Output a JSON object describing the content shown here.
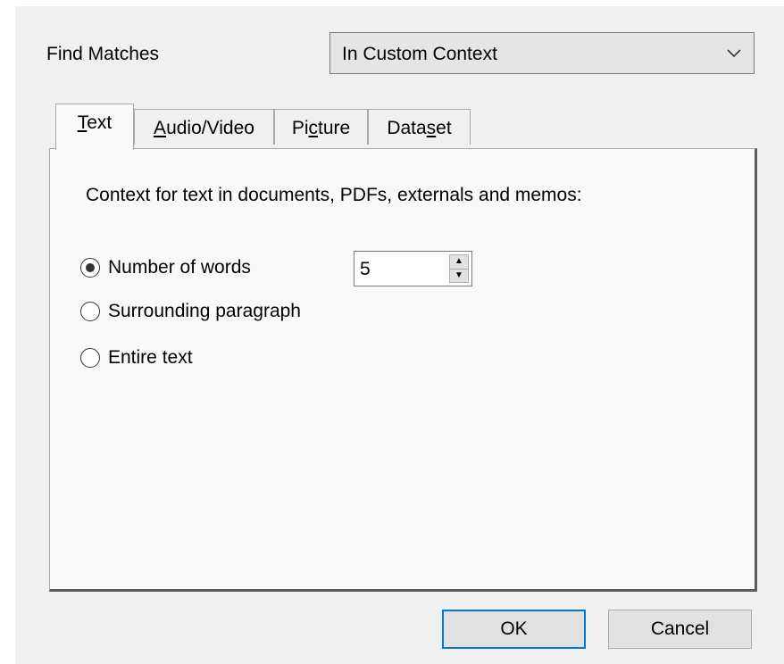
{
  "find_matches": {
    "label": "Find Matches",
    "selected": "In Custom Context",
    "chevron_icon": "chevron-down-icon"
  },
  "tabs": [
    {
      "pre": "",
      "mnemonic": "T",
      "post": "ext",
      "active": true
    },
    {
      "pre": "",
      "mnemonic": "A",
      "post": "udio/Video",
      "active": false
    },
    {
      "pre": "Pi",
      "mnemonic": "c",
      "post": "ture",
      "active": false
    },
    {
      "pre": "Data",
      "mnemonic": "s",
      "post": "et",
      "active": false
    }
  ],
  "text_panel": {
    "description": "Context for text in documents, PDFs, externals and memos:",
    "options": [
      {
        "label": "Number of words",
        "checked": true
      },
      {
        "label": "Surrounding paragraph",
        "checked": false
      },
      {
        "label": "Entire text",
        "checked": false
      }
    ],
    "word_count": "5"
  },
  "buttons": {
    "ok": "OK",
    "cancel": "Cancel"
  },
  "colors": {
    "dialog_background": "#f0f0f0",
    "panel_background": "#f9f9f9",
    "default_button_border": "#0078d7"
  }
}
